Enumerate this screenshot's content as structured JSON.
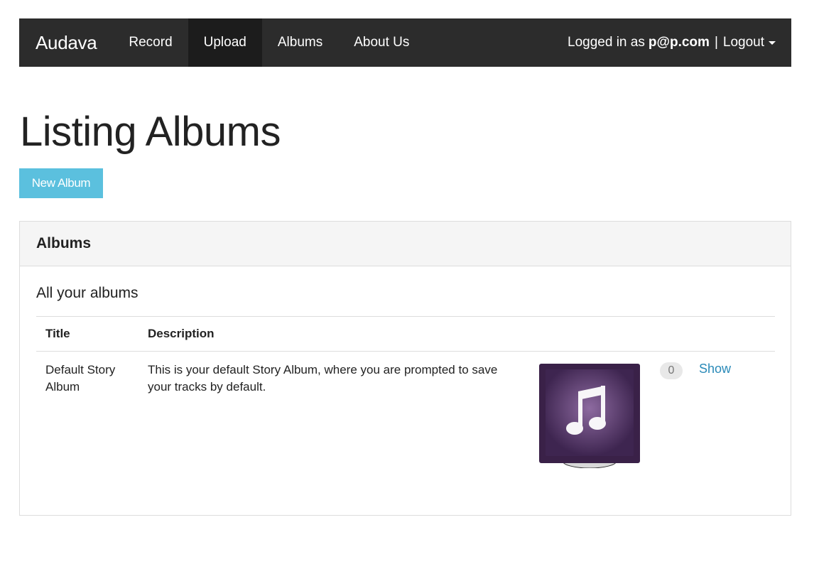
{
  "navbar": {
    "brand": "Audava",
    "items": [
      {
        "label": "Record"
      },
      {
        "label": "Upload"
      },
      {
        "label": "Albums"
      },
      {
        "label": "About Us"
      }
    ],
    "logged_in_prefix": "Logged in as",
    "user": "p@p.com",
    "separator": "|",
    "logout_label": "Logout"
  },
  "page": {
    "title": "Listing Albums",
    "new_album_label": "New Album"
  },
  "panel": {
    "heading": "Albums",
    "subtitle": "All your albums",
    "columns": [
      "Title",
      "Description"
    ],
    "rows": [
      {
        "title": "Default Story Album",
        "description": "This is your default Story Album, where you are prompted to save your tracks by default.",
        "count": "0",
        "action": "Show"
      }
    ]
  },
  "colors": {
    "navbar_bg": "#2c2c2c",
    "button_info": "#5bc0de",
    "link": "#2a8ab8",
    "album_art": "#4a3158"
  },
  "icons": [
    "caret-down-icon",
    "music-note-icon"
  ]
}
